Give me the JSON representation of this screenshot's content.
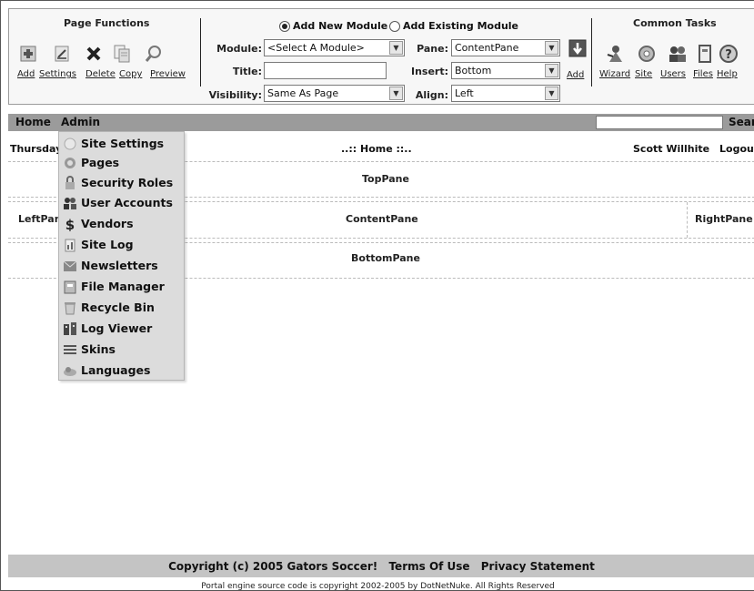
{
  "control_panel": {
    "page_functions": {
      "title": "Page Functions",
      "tools": [
        {
          "label": "Add",
          "icon": "add-page-icon"
        },
        {
          "label": "Settings",
          "icon": "settings-icon"
        },
        {
          "label": "Delete",
          "icon": "delete-icon"
        },
        {
          "label": "Copy",
          "icon": "copy-icon"
        },
        {
          "label": "Preview",
          "icon": "preview-icon"
        }
      ]
    },
    "module": {
      "add_new_label": "Add New Module",
      "add_existing_label": "Add Existing Module",
      "selected_mode": "Add New Module",
      "module_label": "Module:",
      "module_value": "<Select A Module>",
      "title_label": "Title:",
      "title_value": "",
      "visibility_label": "Visibility:",
      "visibility_value": "Same As Page",
      "pane_label": "Pane:",
      "pane_value": "ContentPane",
      "insert_label": "Insert:",
      "insert_value": "Bottom",
      "align_label": "Align:",
      "align_value": "Left",
      "add_label": "Add"
    },
    "common_tasks": {
      "title": "Common Tasks",
      "tools": [
        {
          "label": "Wizard",
          "icon": "wizard-icon"
        },
        {
          "label": "Site",
          "icon": "site-icon"
        },
        {
          "label": "Users",
          "icon": "users-icon"
        },
        {
          "label": "Files",
          "icon": "files-icon"
        },
        {
          "label": "Help",
          "icon": "help-icon"
        }
      ]
    }
  },
  "nav": {
    "items": [
      "Home",
      "Admin"
    ],
    "search_label": "Search",
    "search_value": ""
  },
  "page": {
    "date_text": "Thursday",
    "title": "..:: Home ::..",
    "user_name": "Scott Willhite",
    "logout_label": "Logout",
    "panes": {
      "top": "TopPane",
      "left": "LeftPane",
      "content": "ContentPane",
      "right": "RightPane",
      "bottom": "BottomPane"
    }
  },
  "admin_menu": {
    "items": [
      {
        "label": "Site Settings",
        "icon": "site-settings-icon"
      },
      {
        "label": "Pages",
        "icon": "pages-icon"
      },
      {
        "label": "Security Roles",
        "icon": "security-roles-icon"
      },
      {
        "label": "User Accounts",
        "icon": "user-accounts-icon"
      },
      {
        "label": "Vendors",
        "icon": "dollar-icon"
      },
      {
        "label": "Site Log",
        "icon": "site-log-icon"
      },
      {
        "label": "Newsletters",
        "icon": "newsletter-icon"
      },
      {
        "label": "File Manager",
        "icon": "file-manager-icon"
      },
      {
        "label": "Recycle Bin",
        "icon": "recycle-bin-icon"
      },
      {
        "label": "Log Viewer",
        "icon": "log-viewer-icon"
      },
      {
        "label": "Skins",
        "icon": "skins-icon"
      },
      {
        "label": "Languages",
        "icon": "languages-icon"
      }
    ]
  },
  "footer": {
    "copyright": "Copyright (c) 2005 Gators Soccer!",
    "terms": "Terms Of Use",
    "privacy": "Privacy Statement",
    "note": "Portal engine source code is copyright 2002-2005 by DotNetNuke. All Rights Reserved"
  }
}
